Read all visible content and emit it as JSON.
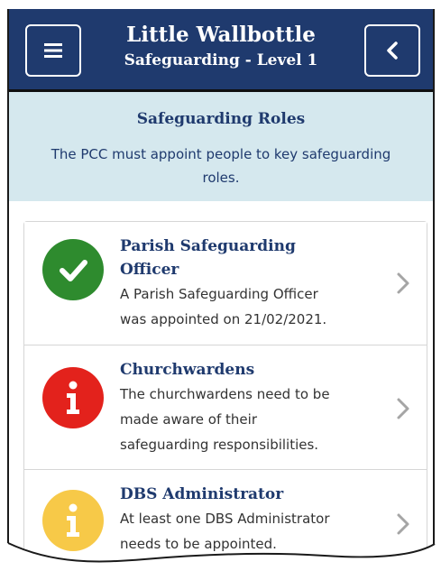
{
  "header": {
    "title": "Little Wallbottle",
    "subtitle": "Safeguarding - Level 1",
    "menu_icon": "hamburger-menu-icon",
    "back_icon": "chevron-left-icon"
  },
  "banner": {
    "title": "Safeguarding Roles",
    "text": "The PCC must appoint people to key safeguarding roles."
  },
  "roles": [
    {
      "title_line1": "Parish Safeguarding",
      "title_line2": "Officer",
      "desc_line1": "A Parish Safeguarding Officer",
      "desc_line2": "was appointed on 21/02/2021.",
      "status": "complete",
      "status_icon": "check-icon",
      "status_color": "#2e8b2e"
    },
    {
      "title": "Churchwardens",
      "desc_line1": "The churchwardens need to be",
      "desc_line2": "made aware of their",
      "desc_line3": "safeguarding responsibilities.",
      "status": "action-required",
      "status_icon": "info-icon",
      "status_color": "#e3221c"
    },
    {
      "title": "DBS Administrator",
      "desc_line1": "At least one DBS Administrator",
      "desc_line2": "needs to be appointed.",
      "status": "warning",
      "status_icon": "info-icon",
      "status_color": "#f7c948"
    }
  ],
  "colors": {
    "header_bg": "#1f3a6e",
    "banner_bg": "#d5e8ee",
    "title_text": "#1f3a6e"
  }
}
